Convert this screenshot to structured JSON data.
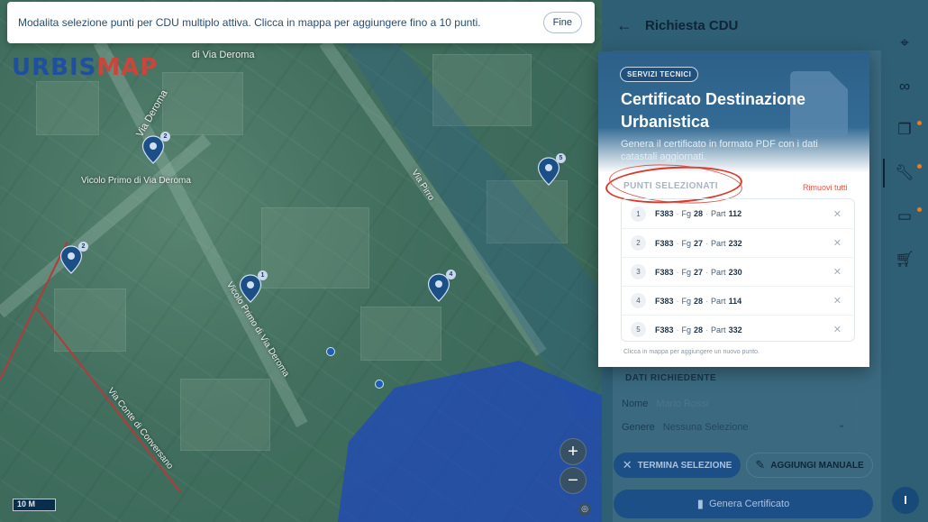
{
  "banner": {
    "message": "Modalita selezione punti per CDU multiplo attiva. Clicca in mappa per aggiungere fino a 10 punti.",
    "done_label": "Fine"
  },
  "map": {
    "logo_part1": "URBIS",
    "logo_part2": "MAP",
    "labels": [
      "di Via Deroma",
      "Via Deroma",
      "Vicolo Primo di Via Deroma",
      "Vicolo Primo di Via Deroma",
      "Via Pirro",
      "Via Conte di Conversano"
    ],
    "pins": [
      "2",
      "2",
      "1",
      "4",
      "5"
    ],
    "scale": "10 M",
    "zoom_in": "+",
    "zoom_out": "−"
  },
  "panel": {
    "title": "Richiesta CDU",
    "back_icon": "arrow-left-icon"
  },
  "card": {
    "tag": "SERVIZI TECNICI",
    "title": "Certificato Destinazione Urbanistica",
    "description": "Genera il certificato in formato PDF con i dati catastali aggiornati.",
    "selected_heading": "PUNTI SELEZIONATI",
    "remove_all": "Rimuovi tutti",
    "points": [
      {
        "n": "1",
        "code": "F383",
        "fg_label": "Fg",
        "fg": "28",
        "part_label": "Part",
        "part": "112"
      },
      {
        "n": "2",
        "code": "F383",
        "fg_label": "Fg",
        "fg": "27",
        "part_label": "Part",
        "part": "232"
      },
      {
        "n": "3",
        "code": "F383",
        "fg_label": "Fg",
        "fg": "27",
        "part_label": "Part",
        "part": "230"
      },
      {
        "n": "4",
        "code": "F383",
        "fg_label": "Fg",
        "fg": "28",
        "part_label": "Part",
        "part": "114"
      },
      {
        "n": "5",
        "code": "F383",
        "fg_label": "Fg",
        "fg": "28",
        "part_label": "Part",
        "part": "332"
      }
    ],
    "hint": "Clicca in mappa per aggiungere un nuovo punto."
  },
  "form": {
    "section": "DATI RICHIEDENTE",
    "nome_label": "Nome",
    "nome_placeholder": "Mario Rossi",
    "genere_label": "Genere",
    "genere_value": "Nessuna Selezione"
  },
  "actions": {
    "termina": "TERMINA SELEZIONE",
    "aggiungi": "AGGIUNGI MANUALE",
    "genera": "Genera Certificato"
  },
  "rail": {
    "icons": [
      "map-pin-icon",
      "binoculars-icon",
      "documents-icon",
      "wrench-icon",
      "folder-icon",
      "cart-icon"
    ]
  },
  "info_fab": "I",
  "colors": {
    "accent": "#1d4f87",
    "danger": "#e0574a",
    "panel_bg": "#2f5f75",
    "brand_blue": "#1e4fa0",
    "brand_red": "#c8463c"
  }
}
